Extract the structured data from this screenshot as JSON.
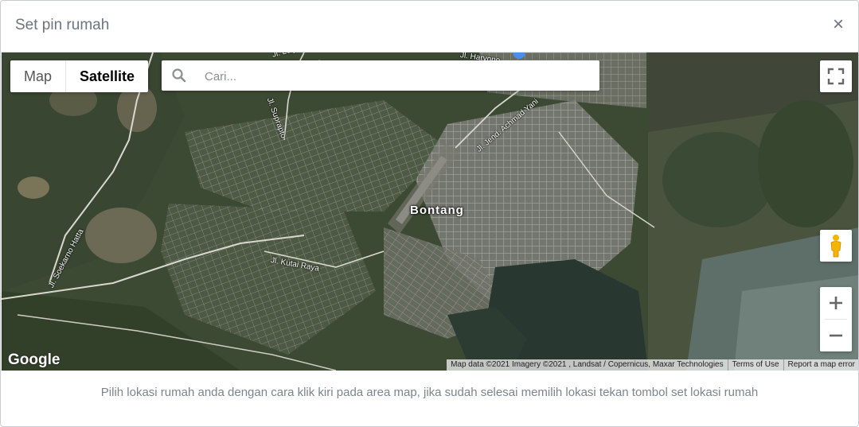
{
  "modal": {
    "title": "Set pin rumah",
    "close_label": "×"
  },
  "map_controls": {
    "map_type": {
      "options": [
        "Map",
        "Satellite"
      ],
      "selected": "Satellite"
    },
    "search": {
      "placeholder": "Cari...",
      "value": "",
      "icon": "search-icon"
    },
    "fullscreen_icon": "fullscreen-icon",
    "street_view_icon": "pegman-icon",
    "zoom_in_label": "+",
    "zoom_out_label": "−"
  },
  "map": {
    "city_label": "Bontang",
    "road_labels": [
      "Jl. Soekarno Hatta",
      "Jl. Kutai Raya",
      "Jl. Jend. Achmad Yani",
      "Jl. Suprapto",
      "Jl. Haryono",
      "Jl. Letjen"
    ],
    "google_logo": "Google",
    "attribution": "Map data ©2021 Imagery ©2021 , Landsat / Copernicus, Maxar Technologies",
    "terms_link": "Terms of Use",
    "report_link": "Report a map error"
  },
  "footer": {
    "instruction": "Pilih lokasi rumah anda dengan cara klik kiri pada area map, jika sudah selesai memilih lokasi tekan tombol set lokasi rumah"
  }
}
